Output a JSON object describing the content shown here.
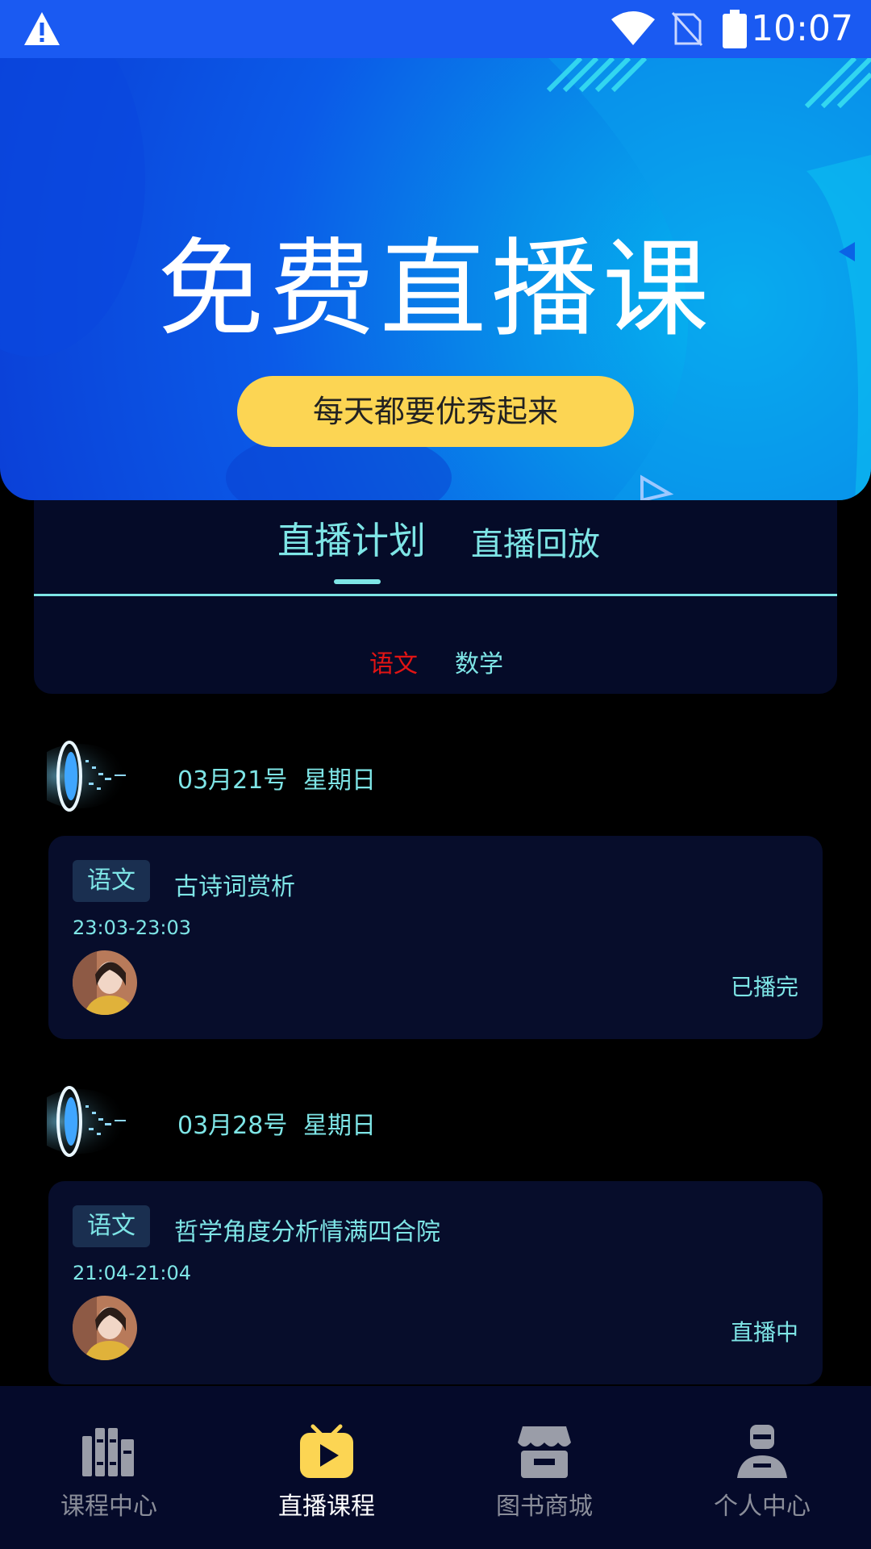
{
  "status_bar": {
    "time": "10:07"
  },
  "banner": {
    "title": "免费直播课",
    "cta_label": "每天都要优秀起来"
  },
  "tabs": {
    "items": [
      {
        "label": "直播计划",
        "active": true
      },
      {
        "label": "直播回放",
        "active": false
      }
    ],
    "subjects": [
      {
        "label": "语文",
        "color": "#e11414",
        "selected": true
      },
      {
        "label": "数学",
        "color": "#7ee5e6",
        "selected": false
      }
    ]
  },
  "days": [
    {
      "date": "03月21号",
      "weekday": "星期日",
      "lesson": {
        "tag": "语文",
        "title": "古诗词赏析",
        "time": "23:03-23:03",
        "status": "已播完"
      }
    },
    {
      "date": "03月28号",
      "weekday": "星期日",
      "lesson": {
        "tag": "语文",
        "title": "哲学角度分析情满四合院",
        "time": "21:04-21:04",
        "status": "直播中"
      }
    }
  ],
  "bottom_nav": {
    "items": [
      {
        "label": "课程中心",
        "icon": "books-icon",
        "active": false
      },
      {
        "label": "直播课程",
        "icon": "tv-play-icon",
        "active": true
      },
      {
        "label": "图书商城",
        "icon": "store-icon",
        "active": false
      },
      {
        "label": "个人中心",
        "icon": "person-icon",
        "active": false
      }
    ]
  },
  "colors": {
    "accent": "#7ee5e6",
    "status_bar": "#1a5af2",
    "cta": "#fcd553",
    "card_bg": "#070d2b",
    "nav_active_icon": "#fcd553"
  }
}
